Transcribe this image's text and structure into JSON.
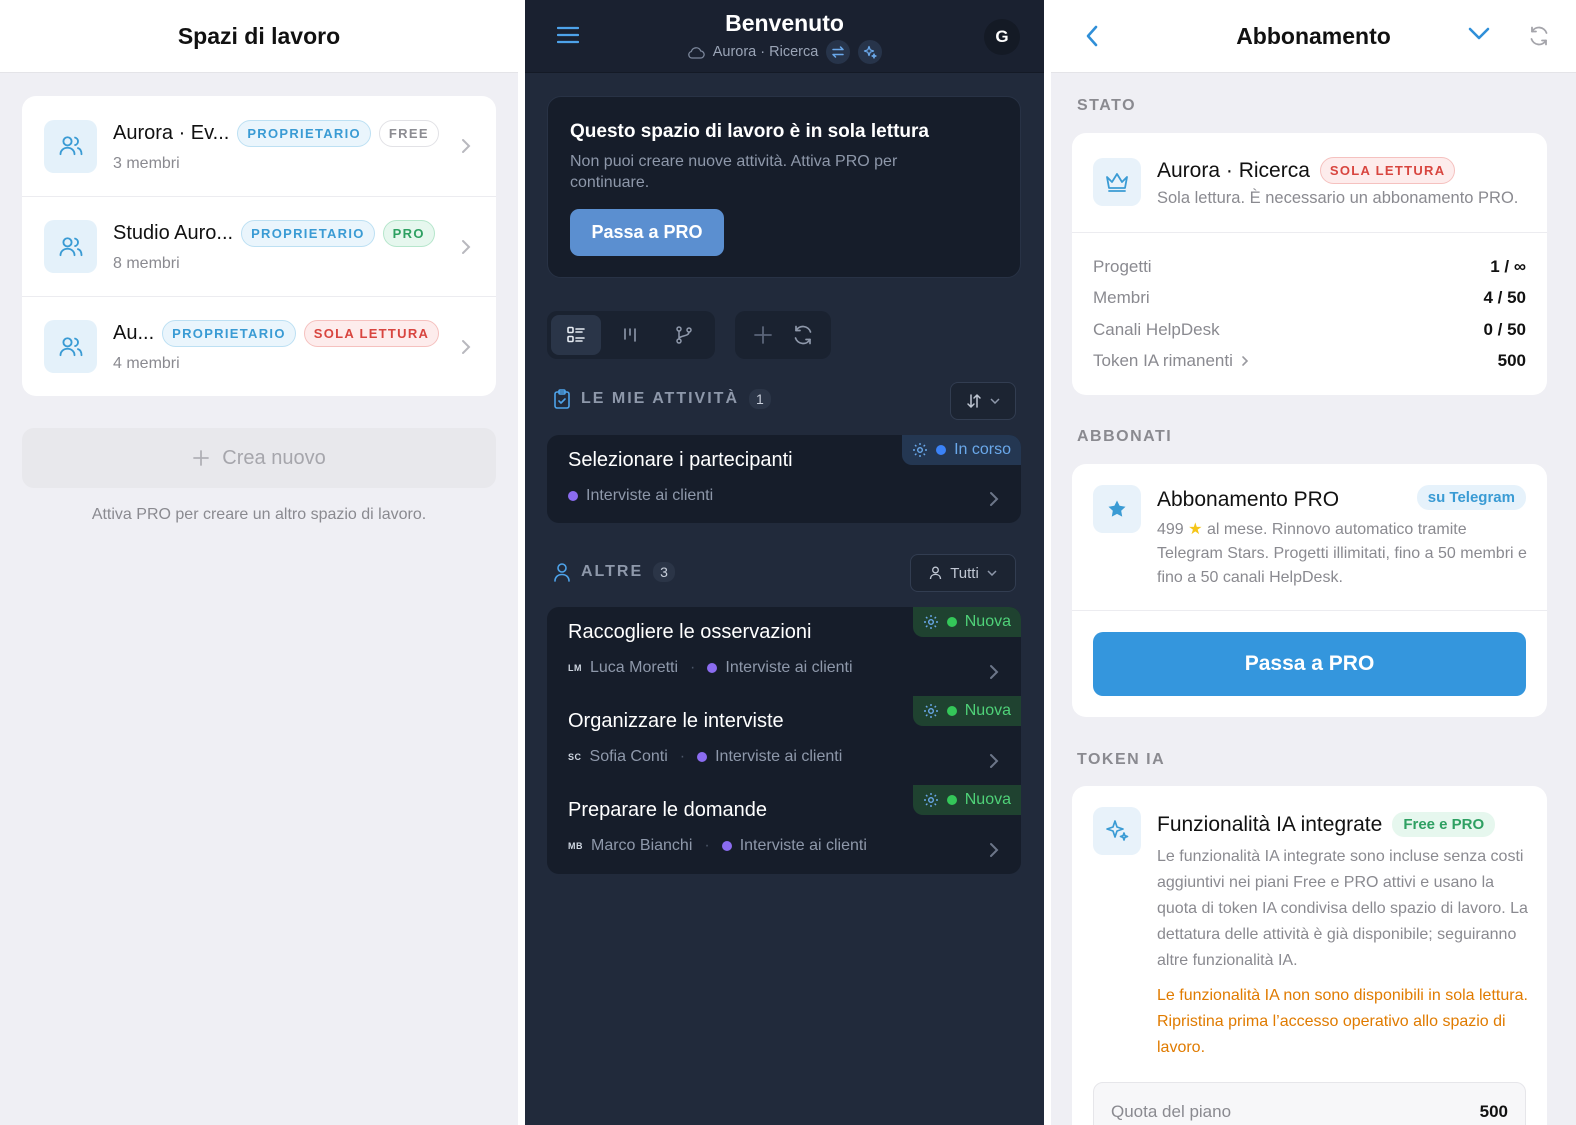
{
  "workspaces_panel": {
    "title": "Spazi di lavoro",
    "items": [
      {
        "name": "Aurora · Ev...",
        "role": "PROPRIETARIO",
        "plan": "FREE",
        "members": "3 membri"
      },
      {
        "name": "Studio Auro...",
        "role": "PROPRIETARIO",
        "plan": "PRO",
        "members": "8 membri"
      },
      {
        "name": "Au...",
        "role": "PROPRIETARIO",
        "plan": "SOLA LETTURA",
        "members": "4 membri"
      }
    ],
    "create_label": "Crea nuovo",
    "create_note": "Attiva PRO per creare un altro spazio di lavoro."
  },
  "home_panel": {
    "title": "Benvenuto",
    "subtitle": "Aurora · Ricerca",
    "avatar_initial": "G",
    "readonly_banner": {
      "title": "Questo spazio di lavoro è in sola lettura",
      "text": "Non puoi creare nuove attività. Attiva PRO per continuare.",
      "button": "Passa a PRO"
    },
    "my_tasks": {
      "label": "LE MIE ATTIVITÀ",
      "count": "1",
      "items": [
        {
          "title": "Selezionare i partecipanti",
          "status": "In corso",
          "project": "Interviste ai clienti"
        }
      ]
    },
    "other_tasks": {
      "label": "ALTRE",
      "count": "3",
      "filter": "Tutti",
      "items": [
        {
          "title": "Raccogliere le osservazioni",
          "status": "Nuova",
          "initials": "LM",
          "assignee": "Luca Moretti",
          "project": "Interviste ai clienti"
        },
        {
          "title": "Organizzare le interviste",
          "status": "Nuova",
          "initials": "SC",
          "assignee": "Sofia Conti",
          "project": "Interviste ai clienti"
        },
        {
          "title": "Preparare le domande",
          "status": "Nuova",
          "initials": "MB",
          "assignee": "Marco Bianchi",
          "project": "Interviste ai clienti"
        }
      ]
    }
  },
  "subscription_panel": {
    "title": "Abbonamento",
    "status_section": "STATO",
    "workspace_name": "Aurora · Ricerca",
    "workspace_badge": "SOLA LETTURA",
    "workspace_note": "Sola lettura. È necessario un abbonamento PRO.",
    "stats": [
      {
        "label": "Progetti",
        "value": "1 / ∞"
      },
      {
        "label": "Membri",
        "value": "4 / 50"
      },
      {
        "label": "Canali HelpDesk",
        "value": "0 / 50"
      },
      {
        "label": "Token IA rimanenti",
        "value": "500"
      }
    ],
    "subscribed_section": "ABBONATI",
    "plan_title": "Abbonamento PRO",
    "plan_badge": "su Telegram",
    "plan_price": "499",
    "plan_desc": "al mese. Rinnovo automatico tramite Telegram Stars. Progetti illimitati, fino a 50 membri e fino a 50 canali HelpDesk.",
    "plan_button": "Passa a PRO",
    "ai_section": "TOKEN IA",
    "ai_title": "Funzionalità IA integrate",
    "ai_badge": "Free e PRO",
    "ai_desc": "Le funzionalità IA integrate sono incluse senza costi aggiuntivi nei piani Free e PRO attivi e usano la quota di token IA condivisa dello spazio di lavoro. La dettatura delle attività è già disponibile; seguiranno altre funzionalità IA.",
    "ai_warning": "Le funzionalità IA non sono disponibili in sola lettura. Ripristina prima l’accesso operativo allo spazio di lavoro.",
    "quota_label": "Quota del piano",
    "quota_value": "500"
  },
  "colors": {
    "accent": "#3496dd",
    "dark_bg": "#212a3b",
    "danger": "#d8453f",
    "success": "#2ea062",
    "warning": "#e07b00"
  }
}
